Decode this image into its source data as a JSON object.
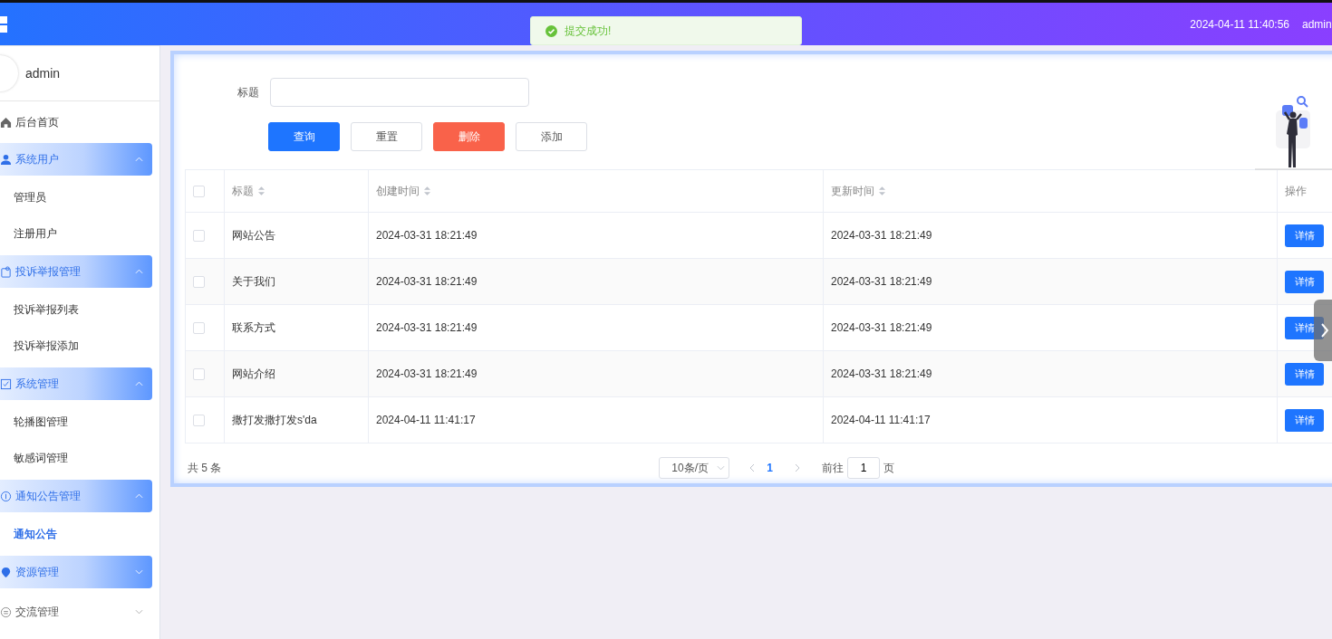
{
  "header": {
    "datetime": "2024-04-11 11:40:56",
    "user": "admin"
  },
  "toast": {
    "message": "提交成功!"
  },
  "sidebar": {
    "user": "admin",
    "menu": [
      {
        "kind": "item",
        "label": "后台首页"
      },
      {
        "kind": "group",
        "label": "系统用户",
        "expanded": true,
        "highlighted": true,
        "children": [
          {
            "label": "管理员",
            "selected": false
          },
          {
            "label": "注册用户",
            "selected": false
          }
        ]
      },
      {
        "kind": "group",
        "label": "投诉举报管理",
        "expanded": true,
        "highlighted": true,
        "children": [
          {
            "label": "投诉举报列表",
            "selected": false
          },
          {
            "label": "投诉举报添加",
            "selected": false
          }
        ]
      },
      {
        "kind": "group",
        "label": "系统管理",
        "expanded": true,
        "highlighted": true,
        "children": [
          {
            "label": "轮播图管理",
            "selected": false
          },
          {
            "label": "敏感词管理",
            "selected": false
          }
        ]
      },
      {
        "kind": "group",
        "label": "通知公告管理",
        "expanded": true,
        "highlighted": true,
        "children": [
          {
            "label": "通知公告",
            "selected": true
          }
        ]
      },
      {
        "kind": "group",
        "label": "资源管理",
        "expanded": false,
        "highlighted": true
      },
      {
        "kind": "group",
        "label": "交流管理",
        "expanded": false,
        "highlighted": false
      }
    ]
  },
  "search": {
    "label": "标题"
  },
  "actions": [
    {
      "label": "查询",
      "kind": "primary"
    },
    {
      "label": "重置",
      "kind": "plain"
    },
    {
      "label": "删除",
      "kind": "danger"
    },
    {
      "label": "添加",
      "kind": "plain"
    }
  ],
  "table": {
    "all_checked": false,
    "columns": [
      {
        "label": "标题",
        "sortable": true
      },
      {
        "label": "创建时间",
        "sortable": true
      },
      {
        "label": "更新时间",
        "sortable": true
      },
      {
        "label": "操作",
        "sortable": false
      }
    ],
    "rows": [
      {
        "checked": false,
        "cells": [
          "网站公告",
          "2024-03-31 18:21:49",
          "2024-03-31 18:21:49"
        ],
        "action": "详情"
      },
      {
        "checked": false,
        "cells": [
          "关于我们",
          "2024-03-31 18:21:49",
          "2024-03-31 18:21:49"
        ],
        "action": "详情"
      },
      {
        "checked": false,
        "cells": [
          "联系方式",
          "2024-03-31 18:21:49",
          "2024-03-31 18:21:49"
        ],
        "action": "详情"
      },
      {
        "checked": false,
        "cells": [
          "网站介绍",
          "2024-03-31 18:21:49",
          "2024-03-31 18:21:49"
        ],
        "action": "详情"
      },
      {
        "checked": false,
        "cells": [
          "撒打发撒打发s'da",
          "2024-04-11 11:41:17",
          "2024-04-11 11:41:17"
        ],
        "action": "详情"
      }
    ]
  },
  "pagination": {
    "total": "共 5 条",
    "page_size": "10条/页",
    "pages": [
      {
        "label": "1",
        "selected": true
      }
    ],
    "goto_label": "前往",
    "goto_value": "1",
    "goto_unit": "页"
  }
}
